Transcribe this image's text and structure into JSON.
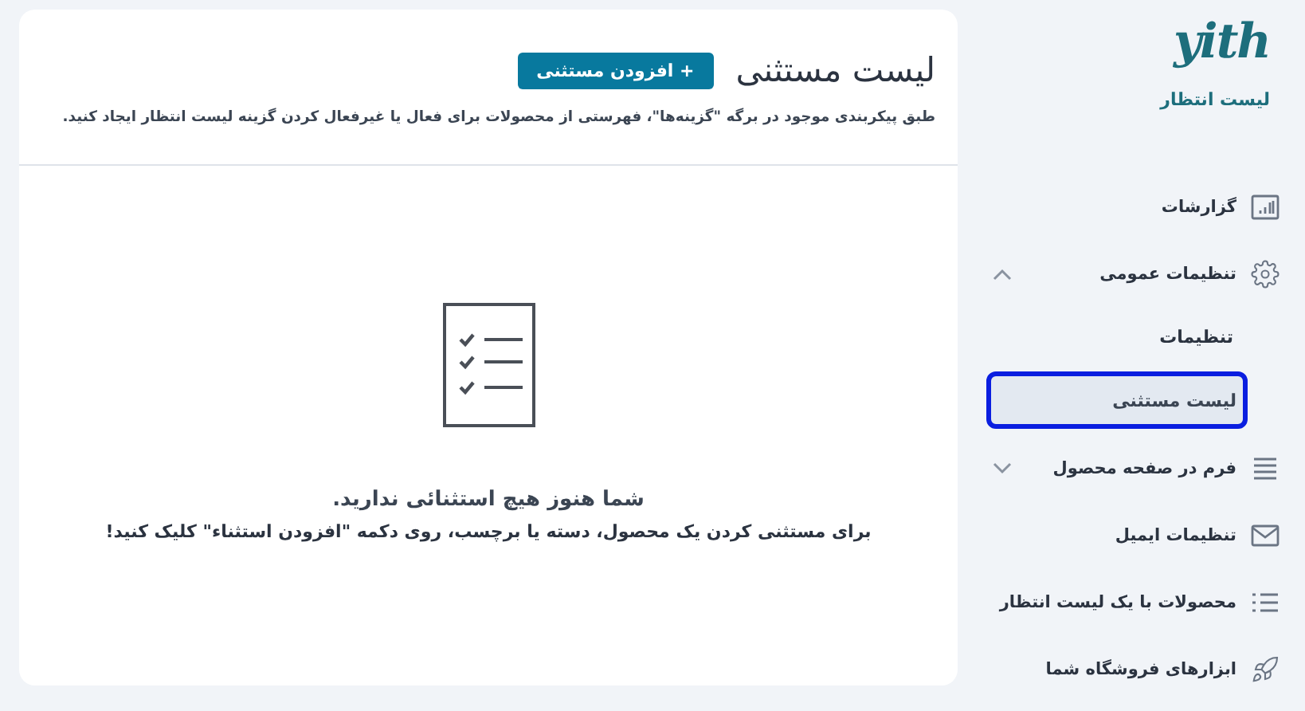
{
  "logo": {
    "wordmark": "yith",
    "subtitle": "لیست انتظار"
  },
  "nav": [
    {
      "label": "گزارشات",
      "selected": false
    },
    {
      "label": "تنظیمات عمومی",
      "selected": false,
      "expanded": true,
      "children": [
        {
          "label": "تنظیمات",
          "selected": false
        },
        {
          "label": "لیست مستثنی",
          "selected": true
        }
      ]
    },
    {
      "label": "فرم در صفحه محصول",
      "selected": false,
      "expanded": false
    },
    {
      "label": "تنظیمات ایمیل",
      "selected": false
    },
    {
      "label": "محصولات با یک لیست انتظار",
      "selected": false
    },
    {
      "label": "ابزارهای فروشگاه شما",
      "selected": false
    }
  ],
  "header": {
    "title": "لیست مستثنی",
    "button": "+ افزودن مستثنی",
    "description": "طبق پیکربندی موجود در برگه \"گزینه‌ها\"، فهرستی از محصولات برای فعال یا غیرفعال کردن گزینه لیست انتظار ایجاد کنید."
  },
  "empty_state": {
    "title": "شما هنوز هیچ استثنائی ندارید.",
    "text": "برای مستثنی کردن یک محصول، دسته یا برچسب، روی دکمه \"افزودن استثناء\" کلیک کنید!"
  }
}
